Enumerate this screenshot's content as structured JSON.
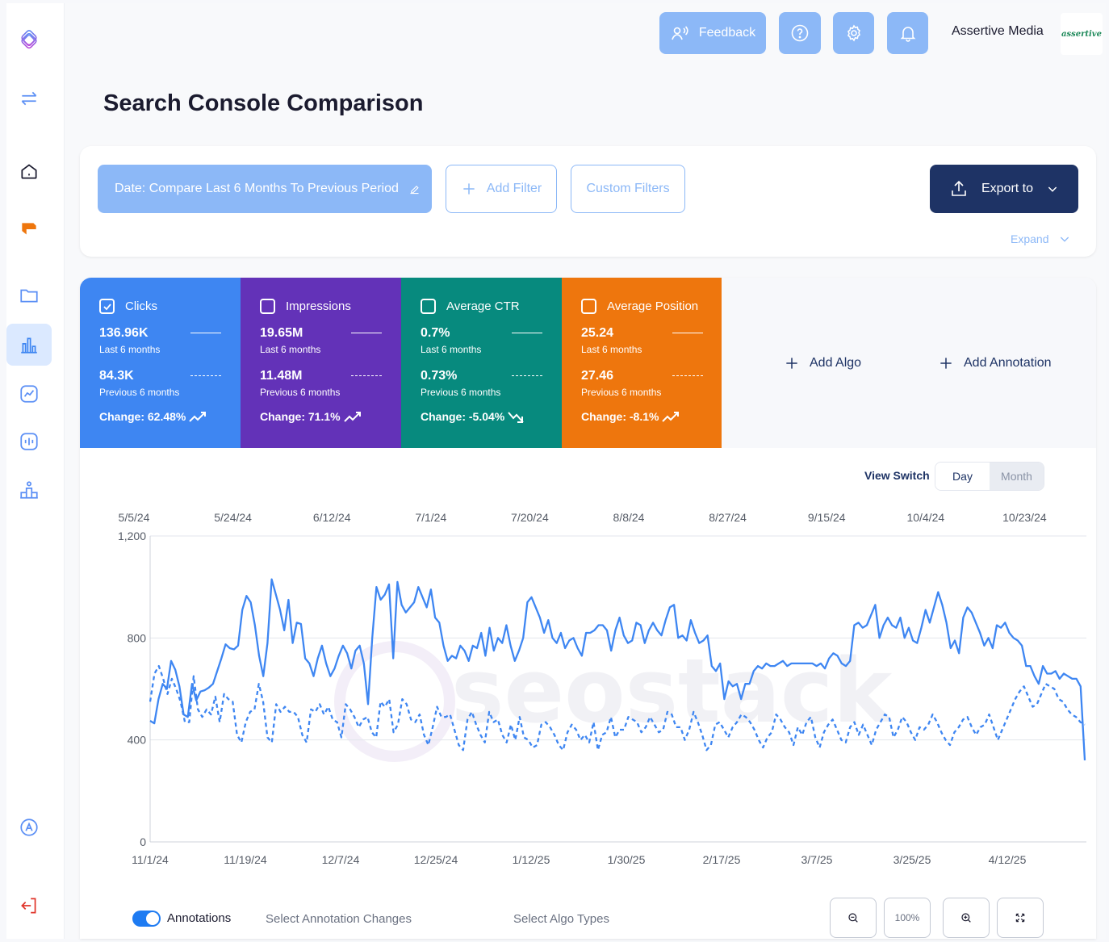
{
  "header": {
    "feedback_label": "Feedback",
    "brand_name": "Assertive Media",
    "brand_logo_text": "assertive"
  },
  "page_title": "Search Console Comparison",
  "filters": {
    "date_label": "Date: Compare Last 6 Months To Previous Period",
    "add_filter_label": "Add Filter",
    "custom_filters_label": "Custom Filters",
    "export_label": "Export to",
    "expand_label": "Expand"
  },
  "metrics": [
    {
      "name": "Clicks",
      "checked": true,
      "color": "#3e86f2",
      "current": "136.96K",
      "current_label": "Last 6 months",
      "previous": "84.3K",
      "previous_label": "Previous 6 months",
      "change": "Change: 62.48%"
    },
    {
      "name": "Impressions",
      "checked": false,
      "color": "#6332b8",
      "current": "19.65M",
      "current_label": "Last 6 months",
      "previous": "11.48M",
      "previous_label": "Previous 6 months",
      "change": "Change: 71.1%"
    },
    {
      "name": "Average CTR",
      "checked": false,
      "color": "#078a7e",
      "current": "0.7%",
      "current_label": "Last 6 months",
      "previous": "0.73%",
      "previous_label": "Previous 6 months",
      "change": "Change: -5.04%"
    },
    {
      "name": "Average Position",
      "checked": false,
      "color": "#ee760d",
      "current": "25.24",
      "current_label": "Last 6 months",
      "previous": "27.46",
      "previous_label": "Previous 6 months",
      "change": "Change: -8.1%"
    }
  ],
  "actions": {
    "add_algo": "Add Algo",
    "add_annotation": "Add Annotation"
  },
  "view_switch": {
    "label": "View Switch",
    "day": "Day",
    "month": "Month",
    "selected": "Day"
  },
  "chart_data": {
    "type": "line",
    "x_top_ticks": [
      "5/5/24",
      "5/24/24",
      "6/12/24",
      "7/1/24",
      "7/20/24",
      "8/8/24",
      "8/27/24",
      "9/15/24",
      "10/4/24",
      "10/23/24"
    ],
    "x_bottom_ticks": [
      "11/1/24",
      "11/19/24",
      "12/7/24",
      "12/25/24",
      "1/12/25",
      "1/30/25",
      "2/17/25",
      "3/7/25",
      "3/25/25",
      "4/12/25"
    ],
    "y_ticks": [
      "0",
      "400",
      "800",
      "1,200"
    ],
    "ylim": [
      0,
      1200
    ],
    "grid": true,
    "series": [
      {
        "color": "#3e86f2",
        "style": "solid",
        "values": [
          475,
          465,
          560,
          620,
          600,
          710,
          675,
          610,
          500,
          490,
          620,
          555,
          590,
          595,
          605,
          620,
          670,
          720,
          775,
          760,
          755,
          770,
          910,
          965,
          940,
          850,
          730,
          650,
          780,
          1030,
          970,
          910,
          830,
          950,
          780,
          860,
          855,
          720,
          700,
          650,
          720,
          770,
          700,
          650,
          680,
          730,
          770,
          740,
          680,
          750,
          770,
          700,
          540,
          800,
          1000,
          950,
          970,
          1010,
          720,
          1020,
          930,
          900,
          920,
          940,
          1000,
          960,
          920,
          990,
          880,
          860,
          770,
          710,
          730,
          720,
          770,
          750,
          710,
          770,
          760,
          820,
          730,
          840,
          750,
          800,
          780,
          850,
          770,
          710,
          750,
          800,
          940,
          960,
          920,
          880,
          820,
          870,
          800,
          780,
          820,
          760,
          790,
          800,
          760,
          730,
          820,
          820,
          830,
          850,
          850,
          830,
          750,
          830,
          880,
          810,
          780,
          790,
          860,
          850,
          780,
          830,
          860,
          830,
          810,
          870,
          920,
          930,
          800,
          810,
          790,
          870,
          820,
          780,
          790,
          810,
          690,
          670,
          700,
          560,
          630,
          610,
          620,
          560,
          620,
          620,
          670,
          690,
          680,
          700,
          690,
          690,
          700,
          710,
          690,
          700,
          700,
          700,
          700,
          700,
          700,
          690,
          700,
          680,
          720,
          740,
          730,
          700,
          690,
          710,
          850,
          860,
          840,
          850,
          890,
          930,
          800,
          850,
          880,
          850,
          840,
          880,
          800,
          840,
          790,
          780,
          840,
          910,
          860,
          920,
          980,
          930,
          860,
          760,
          790,
          740,
          880,
          920,
          900,
          860,
          820,
          770,
          800,
          760,
          850,
          840,
          860,
          820,
          800,
          790,
          770,
          690,
          690,
          650,
          620,
          690,
          660,
          660,
          670,
          640,
          660,
          650,
          640,
          640,
          610,
          320
        ]
      },
      {
        "color": "#3e86f2",
        "style": "dashed",
        "values": [
          550,
          660,
          690,
          640,
          580,
          640,
          600,
          550,
          470,
          470,
          650,
          520,
          490,
          520,
          500,
          570,
          470,
          580,
          560,
          550,
          420,
          390,
          470,
          510,
          520,
          620,
          550,
          410,
          390,
          540,
          510,
          530,
          510,
          510,
          490,
          420,
          390,
          520,
          510,
          540,
          500,
          530,
          480,
          470,
          410,
          540,
          520,
          490,
          450,
          480,
          490,
          430,
          410,
          550,
          530,
          560,
          430,
          460,
          560,
          540,
          480,
          470,
          500,
          420,
          380,
          450,
          530,
          490,
          490,
          500,
          440,
          380,
          360,
          480,
          510,
          460,
          420,
          390,
          510,
          470,
          480,
          420,
          390,
          460,
          400,
          490,
          410,
          400,
          370,
          380,
          460,
          470,
          450,
          420,
          380,
          360,
          430,
          460,
          440,
          400,
          420,
          390,
          470,
          360,
          420,
          430,
          490,
          410,
          440,
          440,
          490,
          480,
          470,
          430,
          450,
          490,
          460,
          430,
          440,
          510,
          500,
          450,
          450,
          400,
          440,
          510,
          470,
          420,
          360,
          380,
          460,
          470,
          440,
          410,
          450,
          470,
          500,
          490,
          470,
          440,
          400,
          370,
          410,
          430,
          500,
          480,
          450,
          430,
          380,
          450,
          420,
          470,
          490,
          410,
          370,
          430,
          460,
          480,
          440,
          400,
          390,
          450,
          470,
          420,
          460,
          420,
          380,
          440,
          470,
          500,
          490,
          410,
          440,
          490,
          470,
          430,
          400,
          450,
          440,
          460,
          500,
          470,
          430,
          400,
          380,
          430,
          450,
          480,
          490,
          450,
          420,
          450,
          460,
          500,
          450,
          400,
          440,
          480,
          520,
          560,
          590,
          610,
          570,
          530,
          540,
          580,
          620,
          610,
          600,
          560,
          550,
          520,
          500,
          490,
          470,
          460
        ]
      }
    ]
  },
  "bottom": {
    "annotations_label": "Annotations",
    "annotations_on": true,
    "select_annotation_changes": "Select Annotation Changes",
    "select_algo_types": "Select Algo Types",
    "zoom_reset_label": "100%"
  },
  "watermark": "seostack"
}
